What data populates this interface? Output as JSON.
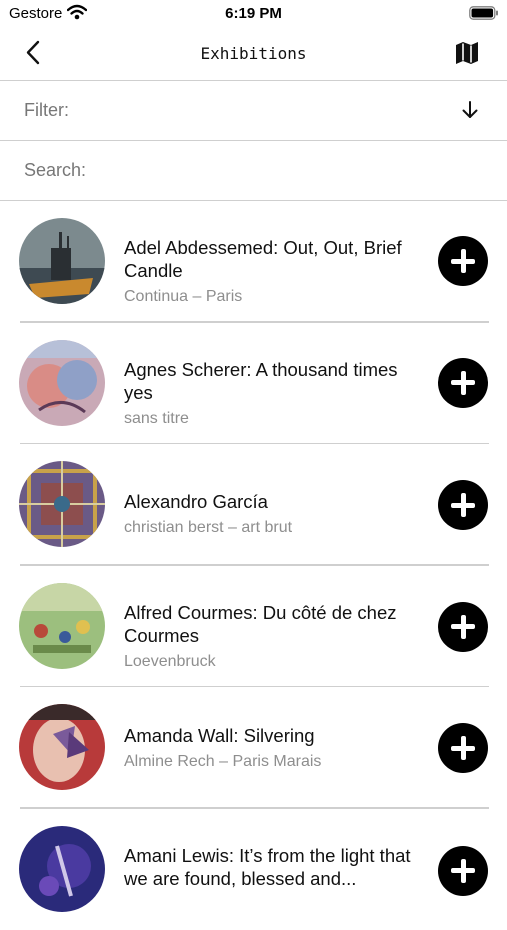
{
  "status_bar": {
    "carrier": "Gestore",
    "time": "6:19 PM"
  },
  "nav": {
    "title": "Exhibitions",
    "back_icon": "chevron-left-icon",
    "map_icon": "map-icon"
  },
  "filter": {
    "label": "Filter:",
    "icon": "arrow-down-icon"
  },
  "search": {
    "label": "Search:"
  },
  "exhibitions": [
    {
      "title": "Adel Abdessemed: Out, Out, Brief Candle",
      "gallery": "Continua – Paris"
    },
    {
      "title": "Agnes Scherer: A thousand times yes",
      "gallery": "sans titre"
    },
    {
      "title": "Alexandro García",
      "gallery": "christian berst – art brut"
    },
    {
      "title": "Alfred Courmes: Du côté de chez Courmes",
      "gallery": "Loevenbruck"
    },
    {
      "title": "Amanda Wall: Silvering",
      "gallery": "Almine Rech – Paris Marais"
    },
    {
      "title": "Amani Lewis: It’s from the light that we are found, blessed and...",
      "gallery": ""
    }
  ],
  "colors": {
    "separator": "#cfcfcf",
    "subtitle": "#8e8e8e",
    "button": "#000000"
  }
}
